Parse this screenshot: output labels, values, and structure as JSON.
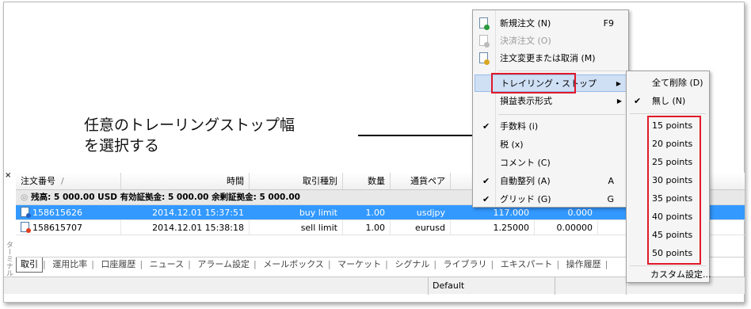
{
  "annotation": {
    "line1": "任意のトレーリングストップ幅",
    "line2": "を選択する"
  },
  "terminal": {
    "close_glyph": "×",
    "side_title": "ターミナル",
    "columns": [
      "注文番号",
      "/",
      "時間",
      "取引種別",
      "数量",
      "通貨ペア"
    ],
    "balance_text": "残高: 5 000.00 USD  有効証拠金: 5 000.00  余剰証拠金: 5 000.00",
    "rows": [
      {
        "order": "158615626",
        "time": "2014.12.01 15:37:51",
        "type": "buy limit",
        "qty": "1.00",
        "symbol": "usdjpy",
        "price": "117.000",
        "rest": "0.000"
      },
      {
        "order": "158615707",
        "time": "2014.12.01 15:38:18",
        "type": "sell limit",
        "qty": "1.00",
        "symbol": "eurusd",
        "price": "1.25000",
        "rest": "0.00000"
      }
    ],
    "tabs": [
      "取引",
      "運用比率",
      "口座履歴",
      "ニュース",
      "アラーム設定",
      "メールボックス",
      "マーケット",
      "シグナル",
      "ライブラリ",
      "エキスパート",
      "操作履歴"
    ],
    "status_default": "Default"
  },
  "context_menu": {
    "new_order": {
      "label": "新規注文 (N)",
      "key": "F9"
    },
    "close_order": {
      "label": "決済注文 (O)"
    },
    "modify_order": {
      "label": "注文変更または取消 (M)"
    },
    "trailing_stop": {
      "label": "トレイリング・ストップ"
    },
    "profit_format": {
      "label": "損益表示形式"
    },
    "commission": {
      "label": "手数料 (i)"
    },
    "tax": {
      "label": "税 (x)"
    },
    "comment": {
      "label": "コメント (C)"
    },
    "auto_arrange": {
      "label": "自動整列 (A)",
      "key": "A"
    },
    "grid": {
      "label": "グリッド (G)",
      "key": "G"
    }
  },
  "submenu": {
    "delete_all": "全て削除 (D)",
    "none": "無し (N)",
    "points": [
      "15 points",
      "20 points",
      "25 points",
      "30 points",
      "35 points",
      "40 points",
      "45 points",
      "50 points"
    ],
    "custom": "カスタム設定..."
  }
}
